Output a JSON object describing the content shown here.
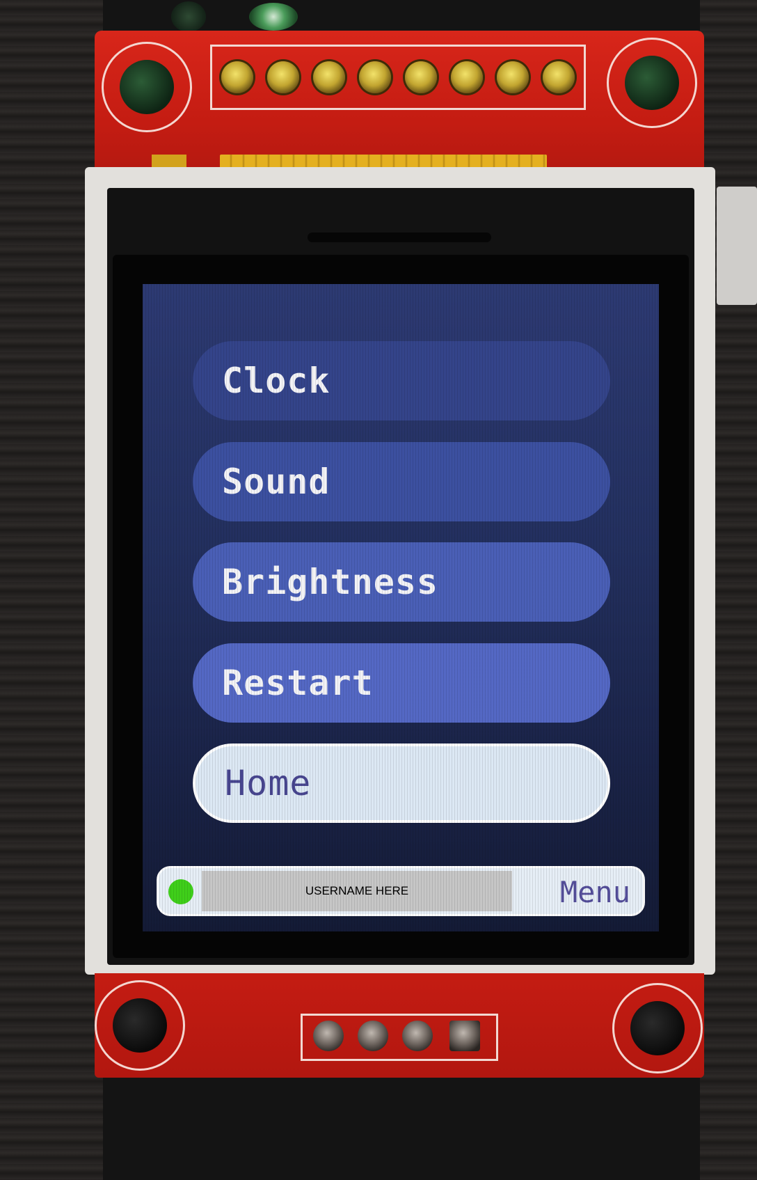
{
  "menu": {
    "items": [
      {
        "label": "Clock"
      },
      {
        "label": "Sound"
      },
      {
        "label": "Brightness"
      },
      {
        "label": "Restart"
      },
      {
        "label": "Home"
      }
    ],
    "selected_index": 4
  },
  "status_bar": {
    "username": "USERNAME HERE",
    "menu_label": "Menu",
    "indicator_color": "#3fcf1a"
  },
  "colors": {
    "screen_background": "#23305f",
    "selected_item": "#dce8f4",
    "pcb": "#c41c12"
  }
}
